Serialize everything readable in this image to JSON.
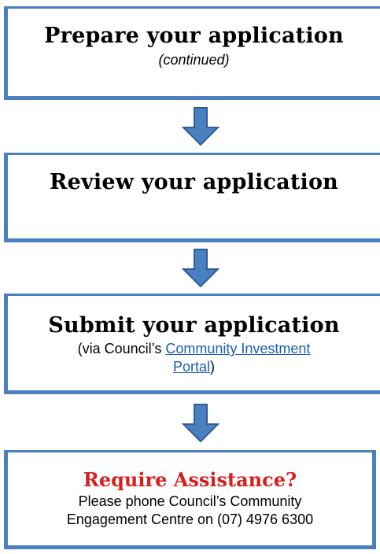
{
  "steps": {
    "prepare": {
      "title": "Prepare your application",
      "subtitle": "(continued)"
    },
    "review": {
      "title": "Review your application"
    },
    "submit": {
      "title": "Submit your application",
      "note_prefix": "(via Council’s ",
      "link_line1": "Community Investment",
      "link_line2": "Portal",
      "note_suffix": ")"
    },
    "assistance": {
      "title": "Require Assistance?",
      "line1": "Please phone Council’s Community",
      "line2": "Engagement Centre on (07) 4976 6300"
    }
  },
  "colors": {
    "border": "#4a7fc0",
    "arrow_fill": "#4a7fc0",
    "arrow_stroke": "#2f5c94",
    "link": "#1a5fb4",
    "assistance_title": "#d81e1e"
  },
  "icons": {
    "arrow": "down-arrow-icon"
  }
}
